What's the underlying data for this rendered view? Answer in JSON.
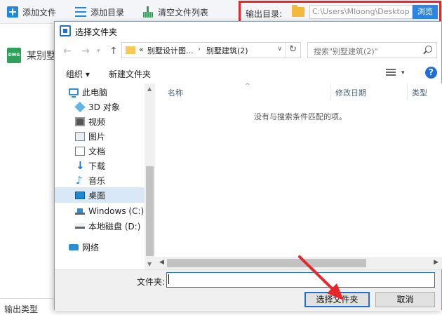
{
  "toolbar": {
    "add_file": "添加文件",
    "add_dir": "添加目录",
    "clear_list": "清空文件列表"
  },
  "output": {
    "label": "输出目录:",
    "path": "C:\\Users\\Mloong\\Desktop",
    "browse": "浏览"
  },
  "file_item": {
    "badge": "DWG",
    "name": "某别墅"
  },
  "bottom_label": "输出类型",
  "dialog": {
    "title": "选择文件夹",
    "address": {
      "prefix": "«",
      "part1": "别墅设计图...",
      "part2": "别墅建筑(2)"
    },
    "search_placeholder": "搜索\"别墅建筑(2)\"",
    "organize": "组织 ▾",
    "new_folder": "新建文件夹",
    "help": "?",
    "nav_items": [
      {
        "label": "此电脑",
        "icon": "computer-icon"
      },
      {
        "label": "3D 对象",
        "icon": "cube-icon"
      },
      {
        "label": "视频",
        "icon": "video-icon"
      },
      {
        "label": "图片",
        "icon": "picture-icon"
      },
      {
        "label": "文档",
        "icon": "document-icon"
      },
      {
        "label": "下载",
        "icon": "download-icon"
      },
      {
        "label": "音乐",
        "icon": "music-icon"
      },
      {
        "label": "桌面",
        "icon": "desktop-icon",
        "selected": true
      },
      {
        "label": "Windows (C:)",
        "icon": "drive-icon"
      },
      {
        "label": "本地磁盘 (D:)",
        "icon": "drive-icon"
      },
      {
        "label": "网络",
        "icon": "network-icon"
      }
    ],
    "columns": {
      "name": "名称",
      "date": "修改日期",
      "type": "类型"
    },
    "empty_message": "没有与搜索条件匹配的项。",
    "folder_label": "文件夹:",
    "folder_value": "",
    "select_button": "选择文件夹",
    "cancel_button": "取消"
  },
  "accent": "#1e6fd6",
  "highlight": "#e8262a"
}
